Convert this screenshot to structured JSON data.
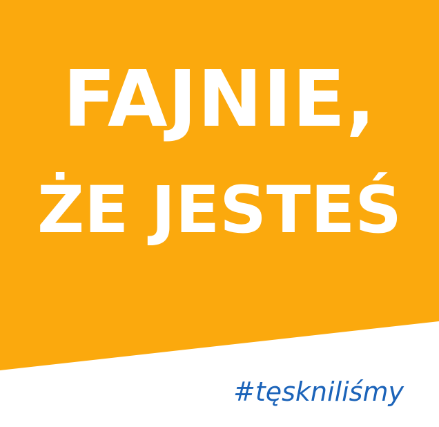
{
  "headline": {
    "line1": "FAJNIE,",
    "line2": "ŻE JESTEŚ"
  },
  "hashtag": "#tęskniliśmy",
  "colors": {
    "background_accent": "#FBA90D",
    "headline_text": "#FFFFFF",
    "hashtag_text": "#1B63B9",
    "footer_background": "#FFFFFF"
  }
}
